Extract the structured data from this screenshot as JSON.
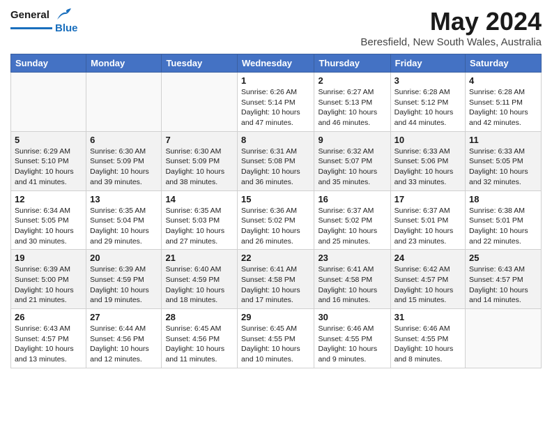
{
  "header": {
    "logo_line1": "General",
    "logo_line2": "Blue",
    "main_title": "May 2024",
    "subtitle": "Beresfield, New South Wales, Australia"
  },
  "weekdays": [
    "Sunday",
    "Monday",
    "Tuesday",
    "Wednesday",
    "Thursday",
    "Friday",
    "Saturday"
  ],
  "weeks": [
    [
      {
        "day": "",
        "info": ""
      },
      {
        "day": "",
        "info": ""
      },
      {
        "day": "",
        "info": ""
      },
      {
        "day": "1",
        "info": "Sunrise: 6:26 AM\nSunset: 5:14 PM\nDaylight: 10 hours\nand 47 minutes."
      },
      {
        "day": "2",
        "info": "Sunrise: 6:27 AM\nSunset: 5:13 PM\nDaylight: 10 hours\nand 46 minutes."
      },
      {
        "day": "3",
        "info": "Sunrise: 6:28 AM\nSunset: 5:12 PM\nDaylight: 10 hours\nand 44 minutes."
      },
      {
        "day": "4",
        "info": "Sunrise: 6:28 AM\nSunset: 5:11 PM\nDaylight: 10 hours\nand 42 minutes."
      }
    ],
    [
      {
        "day": "5",
        "info": "Sunrise: 6:29 AM\nSunset: 5:10 PM\nDaylight: 10 hours\nand 41 minutes."
      },
      {
        "day": "6",
        "info": "Sunrise: 6:30 AM\nSunset: 5:09 PM\nDaylight: 10 hours\nand 39 minutes."
      },
      {
        "day": "7",
        "info": "Sunrise: 6:30 AM\nSunset: 5:09 PM\nDaylight: 10 hours\nand 38 minutes."
      },
      {
        "day": "8",
        "info": "Sunrise: 6:31 AM\nSunset: 5:08 PM\nDaylight: 10 hours\nand 36 minutes."
      },
      {
        "day": "9",
        "info": "Sunrise: 6:32 AM\nSunset: 5:07 PM\nDaylight: 10 hours\nand 35 minutes."
      },
      {
        "day": "10",
        "info": "Sunrise: 6:33 AM\nSunset: 5:06 PM\nDaylight: 10 hours\nand 33 minutes."
      },
      {
        "day": "11",
        "info": "Sunrise: 6:33 AM\nSunset: 5:05 PM\nDaylight: 10 hours\nand 32 minutes."
      }
    ],
    [
      {
        "day": "12",
        "info": "Sunrise: 6:34 AM\nSunset: 5:05 PM\nDaylight: 10 hours\nand 30 minutes."
      },
      {
        "day": "13",
        "info": "Sunrise: 6:35 AM\nSunset: 5:04 PM\nDaylight: 10 hours\nand 29 minutes."
      },
      {
        "day": "14",
        "info": "Sunrise: 6:35 AM\nSunset: 5:03 PM\nDaylight: 10 hours\nand 27 minutes."
      },
      {
        "day": "15",
        "info": "Sunrise: 6:36 AM\nSunset: 5:02 PM\nDaylight: 10 hours\nand 26 minutes."
      },
      {
        "day": "16",
        "info": "Sunrise: 6:37 AM\nSunset: 5:02 PM\nDaylight: 10 hours\nand 25 minutes."
      },
      {
        "day": "17",
        "info": "Sunrise: 6:37 AM\nSunset: 5:01 PM\nDaylight: 10 hours\nand 23 minutes."
      },
      {
        "day": "18",
        "info": "Sunrise: 6:38 AM\nSunset: 5:01 PM\nDaylight: 10 hours\nand 22 minutes."
      }
    ],
    [
      {
        "day": "19",
        "info": "Sunrise: 6:39 AM\nSunset: 5:00 PM\nDaylight: 10 hours\nand 21 minutes."
      },
      {
        "day": "20",
        "info": "Sunrise: 6:39 AM\nSunset: 4:59 PM\nDaylight: 10 hours\nand 19 minutes."
      },
      {
        "day": "21",
        "info": "Sunrise: 6:40 AM\nSunset: 4:59 PM\nDaylight: 10 hours\nand 18 minutes."
      },
      {
        "day": "22",
        "info": "Sunrise: 6:41 AM\nSunset: 4:58 PM\nDaylight: 10 hours\nand 17 minutes."
      },
      {
        "day": "23",
        "info": "Sunrise: 6:41 AM\nSunset: 4:58 PM\nDaylight: 10 hours\nand 16 minutes."
      },
      {
        "day": "24",
        "info": "Sunrise: 6:42 AM\nSunset: 4:57 PM\nDaylight: 10 hours\nand 15 minutes."
      },
      {
        "day": "25",
        "info": "Sunrise: 6:43 AM\nSunset: 4:57 PM\nDaylight: 10 hours\nand 14 minutes."
      }
    ],
    [
      {
        "day": "26",
        "info": "Sunrise: 6:43 AM\nSunset: 4:57 PM\nDaylight: 10 hours\nand 13 minutes."
      },
      {
        "day": "27",
        "info": "Sunrise: 6:44 AM\nSunset: 4:56 PM\nDaylight: 10 hours\nand 12 minutes."
      },
      {
        "day": "28",
        "info": "Sunrise: 6:45 AM\nSunset: 4:56 PM\nDaylight: 10 hours\nand 11 minutes."
      },
      {
        "day": "29",
        "info": "Sunrise: 6:45 AM\nSunset: 4:55 PM\nDaylight: 10 hours\nand 10 minutes."
      },
      {
        "day": "30",
        "info": "Sunrise: 6:46 AM\nSunset: 4:55 PM\nDaylight: 10 hours\nand 9 minutes."
      },
      {
        "day": "31",
        "info": "Sunrise: 6:46 AM\nSunset: 4:55 PM\nDaylight: 10 hours\nand 8 minutes."
      },
      {
        "day": "",
        "info": ""
      }
    ]
  ]
}
